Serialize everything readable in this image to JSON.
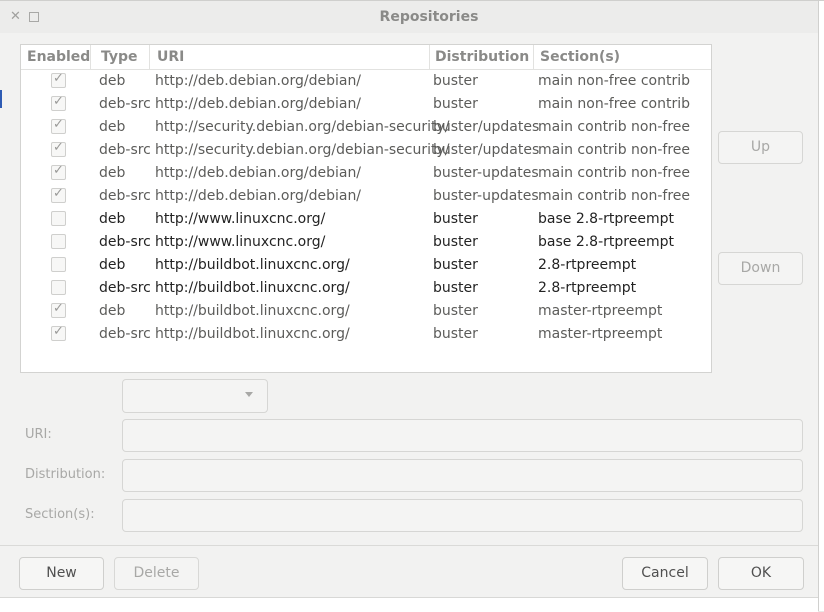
{
  "window": {
    "title": "Repositories"
  },
  "headers": {
    "enabled": "Enabled",
    "type": "Type",
    "uri": "URI",
    "distribution": "Distribution",
    "sections": "Section(s)"
  },
  "rows": [
    {
      "enabled": true,
      "type": "deb",
      "uri": "http://deb.debian.org/debian/",
      "dist": "buster",
      "sections": "main non-free contrib"
    },
    {
      "enabled": true,
      "type": "deb-src",
      "uri": "http://deb.debian.org/debian/",
      "dist": "buster",
      "sections": "main non-free contrib"
    },
    {
      "enabled": true,
      "type": "deb",
      "uri": "http://security.debian.org/debian-security/",
      "dist": "buster/updates",
      "sections": "main contrib non-free"
    },
    {
      "enabled": true,
      "type": "deb-src",
      "uri": "http://security.debian.org/debian-security/",
      "dist": "buster/updates",
      "sections": "main contrib non-free"
    },
    {
      "enabled": true,
      "type": "deb",
      "uri": "http://deb.debian.org/debian/",
      "dist": "buster-updates",
      "sections": "main contrib non-free"
    },
    {
      "enabled": true,
      "type": "deb-src",
      "uri": "http://deb.debian.org/debian/",
      "dist": "buster-updates",
      "sections": "main contrib non-free"
    },
    {
      "enabled": false,
      "type": "deb",
      "uri": "http://www.linuxcnc.org/",
      "dist": "buster",
      "sections": "base 2.8-rtpreempt"
    },
    {
      "enabled": false,
      "type": "deb-src",
      "uri": "http://www.linuxcnc.org/",
      "dist": "buster",
      "sections": "base 2.8-rtpreempt"
    },
    {
      "enabled": false,
      "type": "deb",
      "uri": "http://buildbot.linuxcnc.org/",
      "dist": "buster",
      "sections": "2.8-rtpreempt"
    },
    {
      "enabled": false,
      "type": "deb-src",
      "uri": "http://buildbot.linuxcnc.org/",
      "dist": "buster",
      "sections": "2.8-rtpreempt"
    },
    {
      "enabled": true,
      "type": "deb",
      "uri": "http://buildbot.linuxcnc.org/",
      "dist": "buster",
      "sections": "master-rtpreempt"
    },
    {
      "enabled": true,
      "type": "deb-src",
      "uri": "http://buildbot.linuxcnc.org/",
      "dist": "buster",
      "sections": "master-rtpreempt"
    }
  ],
  "side_buttons": {
    "up": "Up",
    "down": "Down"
  },
  "form": {
    "type_value": "",
    "uri_label": "URI:",
    "uri_value": "",
    "distribution_label": "Distribution:",
    "distribution_value": "",
    "sections_label": "Section(s):",
    "sections_value": ""
  },
  "buttons": {
    "new": "New",
    "delete": "Delete",
    "cancel": "Cancel",
    "ok": "OK"
  },
  "colors": {
    "enabled_text": "#5c5c5a",
    "disabled_text": "#232323",
    "window_bg": "#f2f2f1"
  }
}
